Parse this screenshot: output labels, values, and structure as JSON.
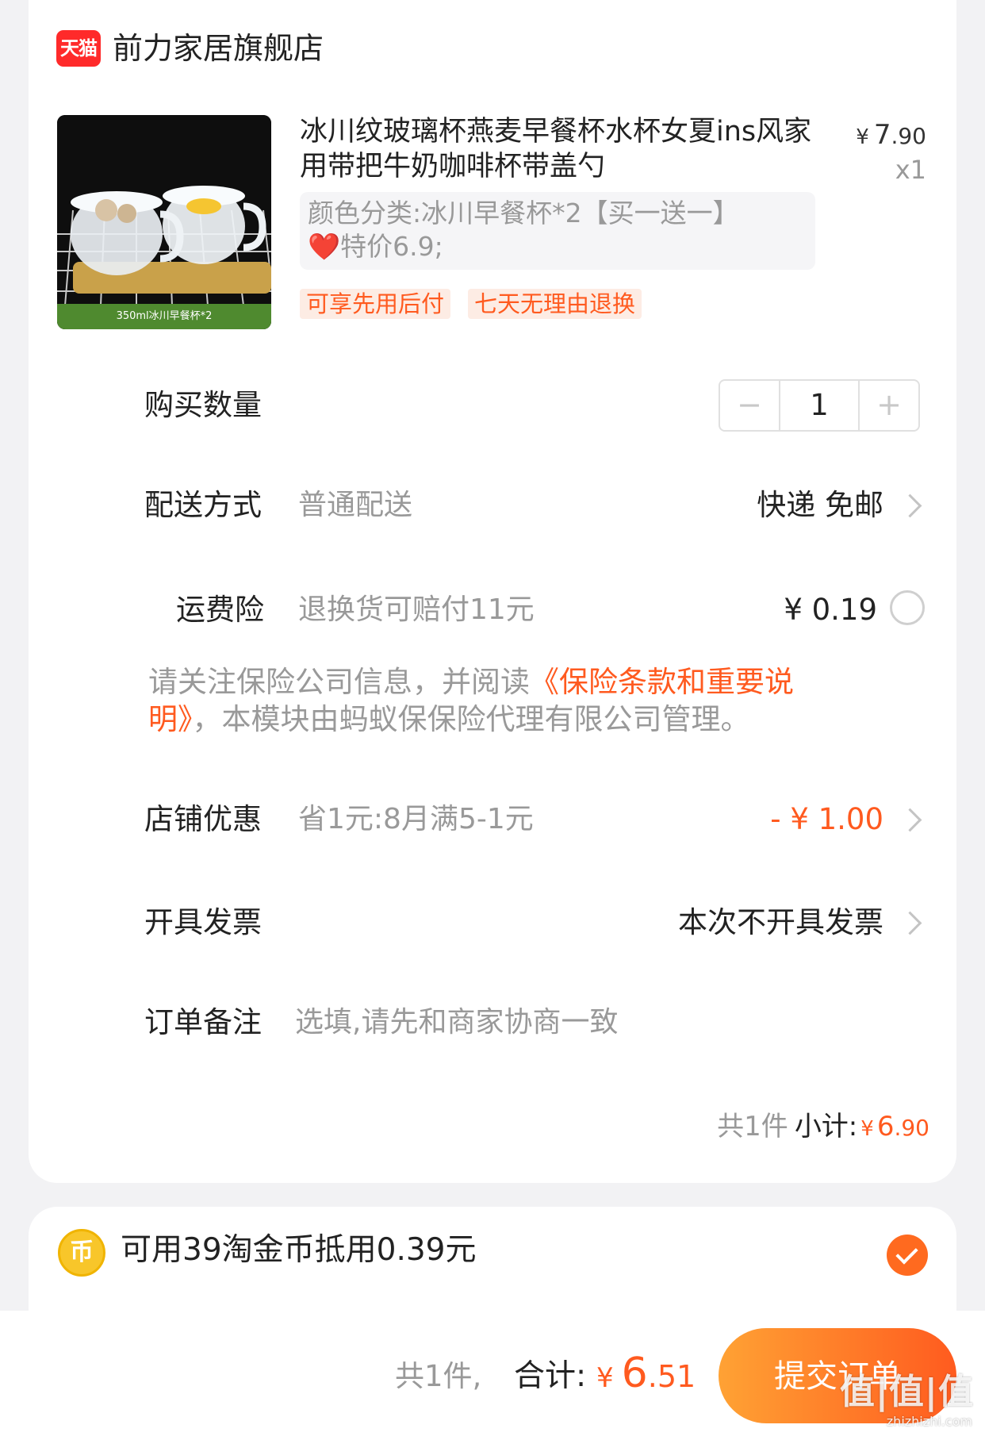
{
  "store": {
    "logo_text": "天猫",
    "name": "前力家居旗舰店"
  },
  "product": {
    "image_banner": "350ml冰川早餐杯*2",
    "title": "冰川纹玻璃杯燕麦早餐杯水杯女夏ins风家用带把牛奶咖啡杯带盖勺",
    "price_currency": "¥",
    "price_int": "7",
    "price_dec": ".90",
    "quantity": "x1",
    "sku_line1": "颜色分类:冰川早餐杯*2【买一送一】",
    "sku_heart": "❤️",
    "sku_line2": "特价6.9;",
    "tags": [
      "可享先用后付",
      "七天无理由退换"
    ]
  },
  "quantity_row": {
    "label": "购买数量",
    "minus": "−",
    "value": "1",
    "plus": "+"
  },
  "delivery": {
    "label": "配送方式",
    "method": "普通配送",
    "value": "快递 免邮"
  },
  "insurance": {
    "label": "运费险",
    "desc": "退换货可赔付11元",
    "price": "¥ 0.19"
  },
  "notice": {
    "text_before": "请关注保险公司信息，并阅读",
    "link": "《保险条款和重要说明》",
    "text_after": "，本模块由蚂蚁保保险代理有限公司管理。"
  },
  "store_discount": {
    "label": "店铺优惠",
    "desc": "省1元:8月满5-1元",
    "value": "- ¥ 1.00"
  },
  "invoice": {
    "label": "开具发票",
    "value": "本次不开具发票"
  },
  "remark": {
    "label": "订单备注",
    "placeholder": "选填,请先和商家协商一致"
  },
  "subtotal": {
    "count": "共1件",
    "label": "小计:",
    "currency": "¥",
    "int": "6",
    "dec": ".90"
  },
  "coins": {
    "icon_text": "币",
    "text": "可用39淘金币抵用0.39元"
  },
  "footer": {
    "count": "共1件,",
    "label": "合计:",
    "currency": "¥",
    "int": "6",
    "dec": ".51",
    "submit": "提交订单"
  },
  "watermark": {
    "text": "值|值|值",
    "sub": "zhizhizhi.com"
  },
  "colors": {
    "accent": "#ff5a1f",
    "tmall_red": "#ff2a2a",
    "submit_gradient_start": "#ffa234",
    "submit_gradient_end": "#ff5b1f"
  }
}
